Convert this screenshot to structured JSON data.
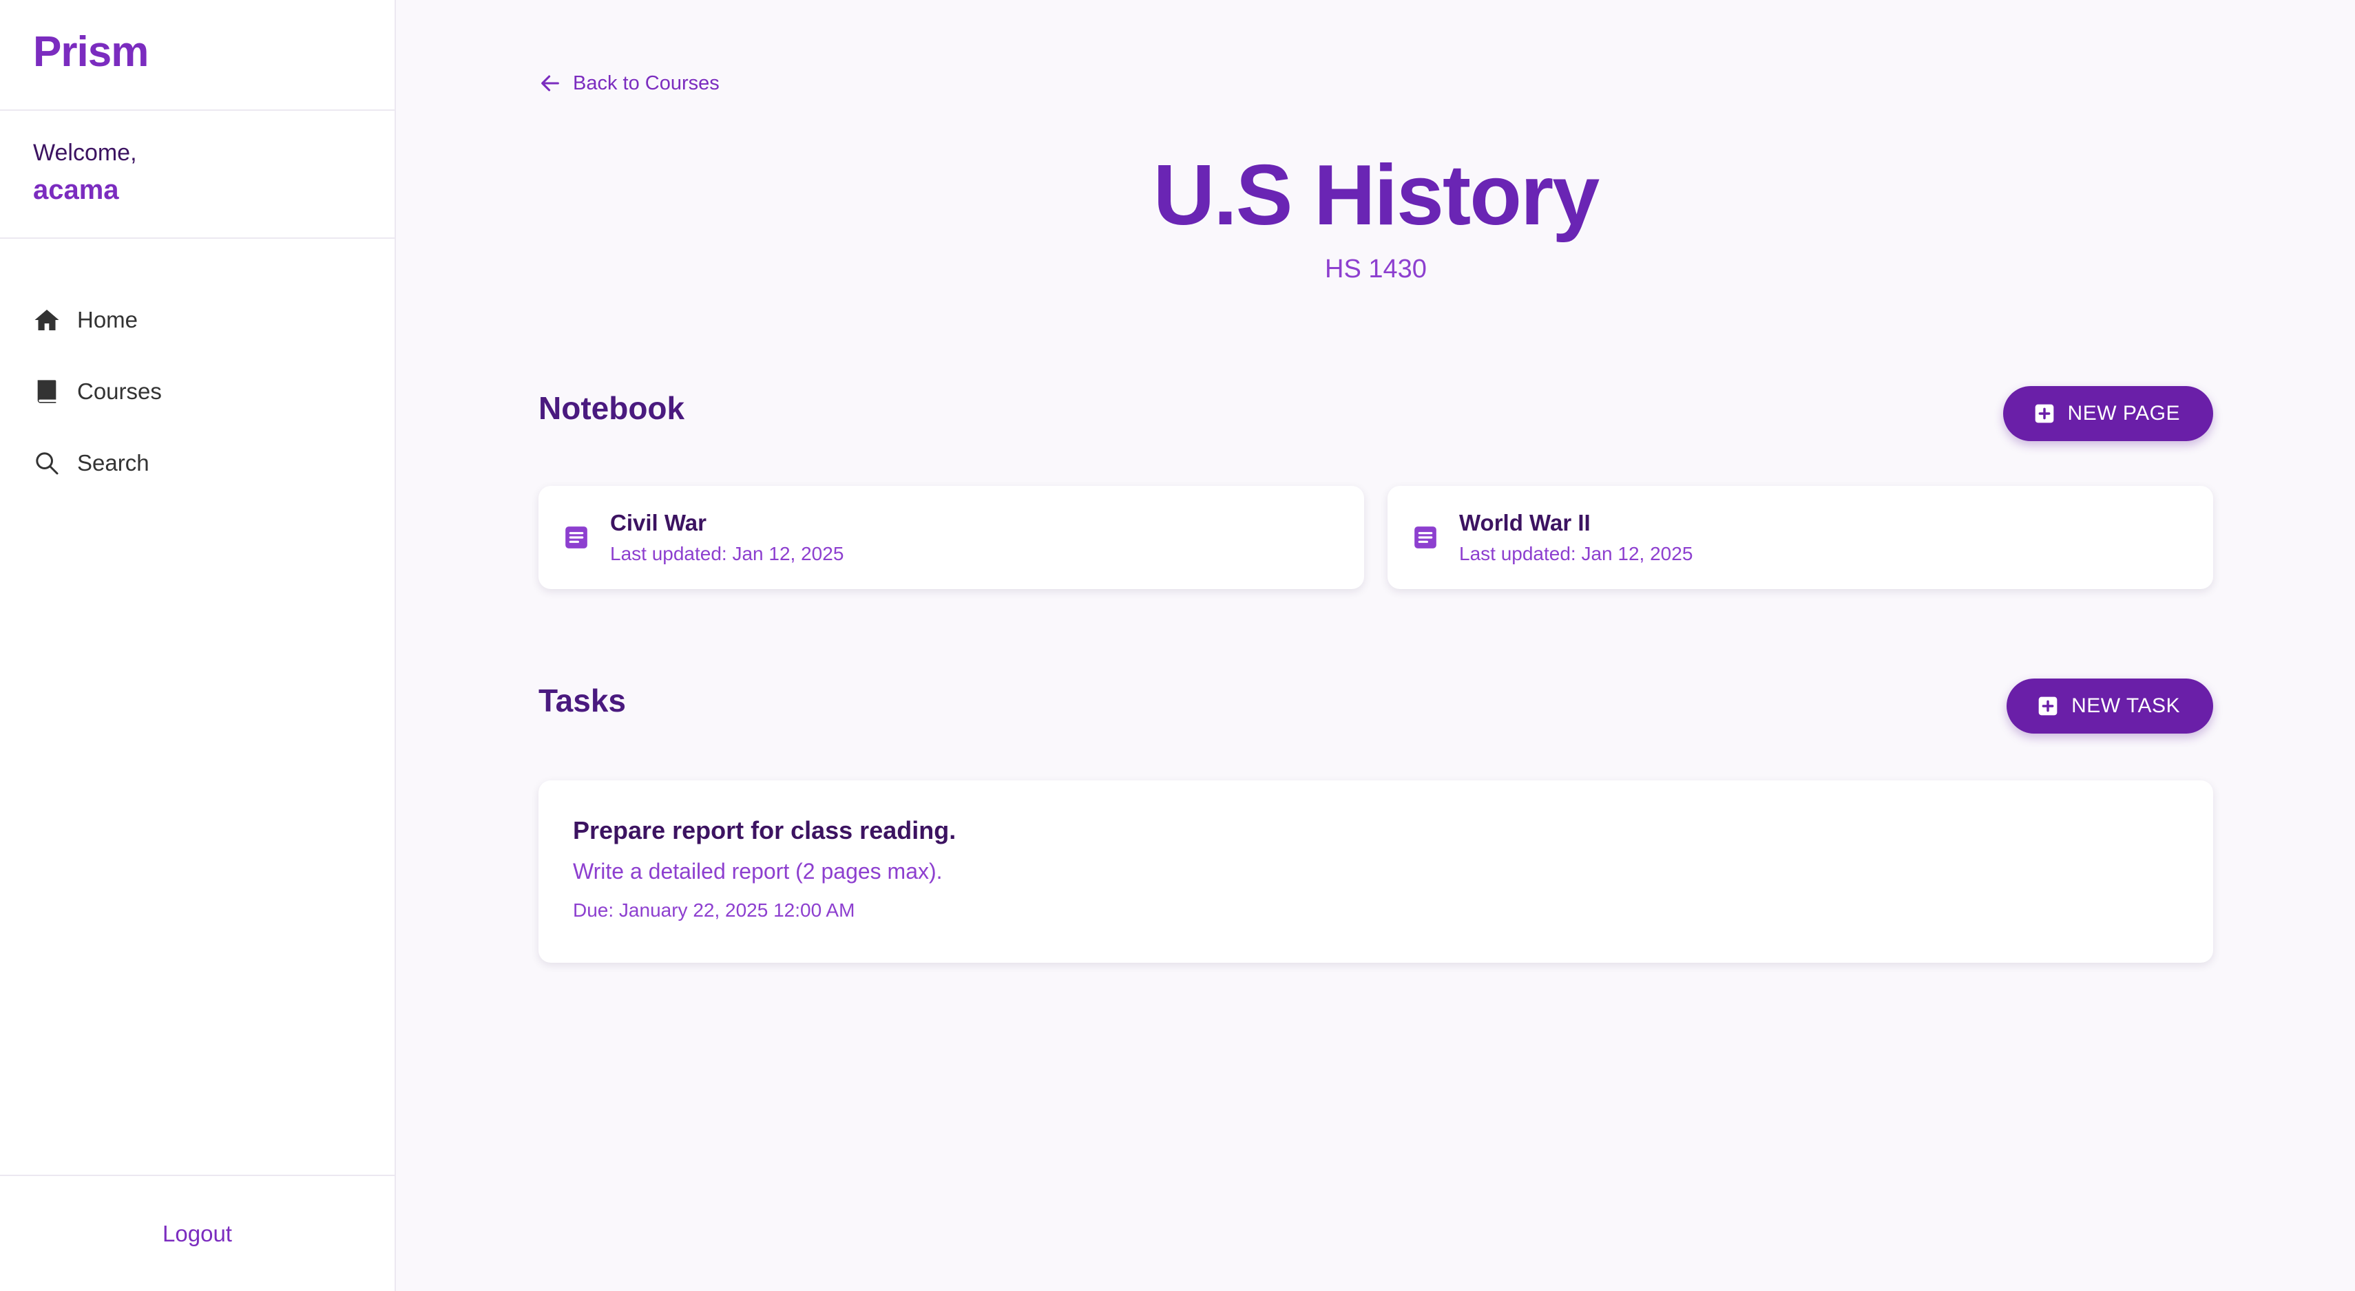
{
  "sidebar": {
    "brand": "Prism",
    "welcome_label": "Welcome,",
    "username": "acama",
    "nav": [
      {
        "label": "Home",
        "icon": "home-icon"
      },
      {
        "label": "Courses",
        "icon": "book-icon"
      },
      {
        "label": "Search",
        "icon": "search-icon"
      }
    ],
    "logout_label": "Logout"
  },
  "main": {
    "back_label": "Back to Courses",
    "course_title": "U.S History",
    "course_code": "HS 1430",
    "notebook": {
      "title": "Notebook",
      "new_button_label": "NEW PAGE",
      "pages": [
        {
          "title": "Civil War",
          "updated": "Last updated: Jan 12, 2025"
        },
        {
          "title": "World War II",
          "updated": "Last updated: Jan 12, 2025"
        }
      ]
    },
    "tasks": {
      "title": "Tasks",
      "new_button_label": "NEW TASK",
      "items": [
        {
          "title": "Prepare report for class reading.",
          "description": "Write a detailed report (2 pages max).",
          "due": "Due: January 22, 2025 12:00 AM"
        }
      ]
    }
  },
  "colors": {
    "accent": "#7b2cbf",
    "button": "#6a1fa8",
    "heading": "#4a1a7f",
    "background": "#faf8fc"
  }
}
